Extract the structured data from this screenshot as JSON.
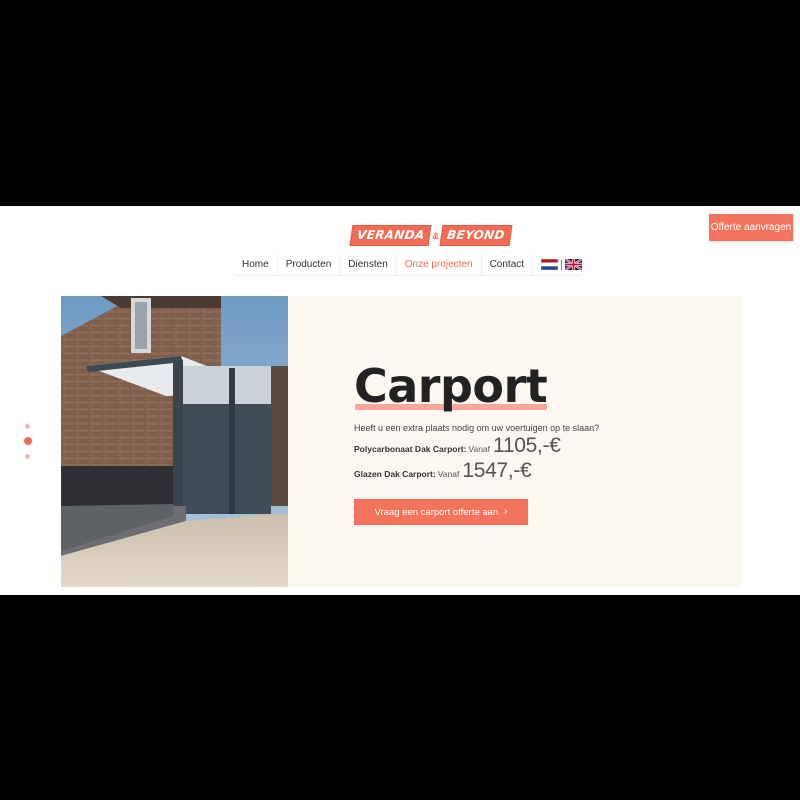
{
  "header": {
    "logo": {
      "part1": "VERANDA",
      "amp": "&",
      "part2": "BEYOND"
    },
    "cta_label": "Offerte aanvragen"
  },
  "nav": {
    "items": [
      {
        "label": "Home",
        "active": false
      },
      {
        "label": "Producten",
        "active": false
      },
      {
        "label": "Diensten",
        "active": false
      },
      {
        "label": "Onze projecten",
        "active": true
      },
      {
        "label": "Contact",
        "active": false
      }
    ],
    "languages": [
      "nl-flag-icon",
      "uk-flag-icon"
    ]
  },
  "hero": {
    "title": "Carport",
    "subtitle": "Heeft u een extra plaats nodig om uw voertuigen op te slaan?",
    "prices": [
      {
        "name": "Polycarbonaat Dak Carport:",
        "prefix": "Vanaf",
        "value": "1105,-€"
      },
      {
        "name": "Glazen Dak Carport:",
        "prefix": "Vanaf",
        "value": "1547,-€"
      }
    ],
    "cta_label": "Vraag een carport offerte aan"
  },
  "slider": {
    "dots": 3,
    "active_index": 1
  },
  "colors": {
    "accent": "#f26b55",
    "panel_bg": "#fdf7f2",
    "underline": "#f9a79a"
  }
}
